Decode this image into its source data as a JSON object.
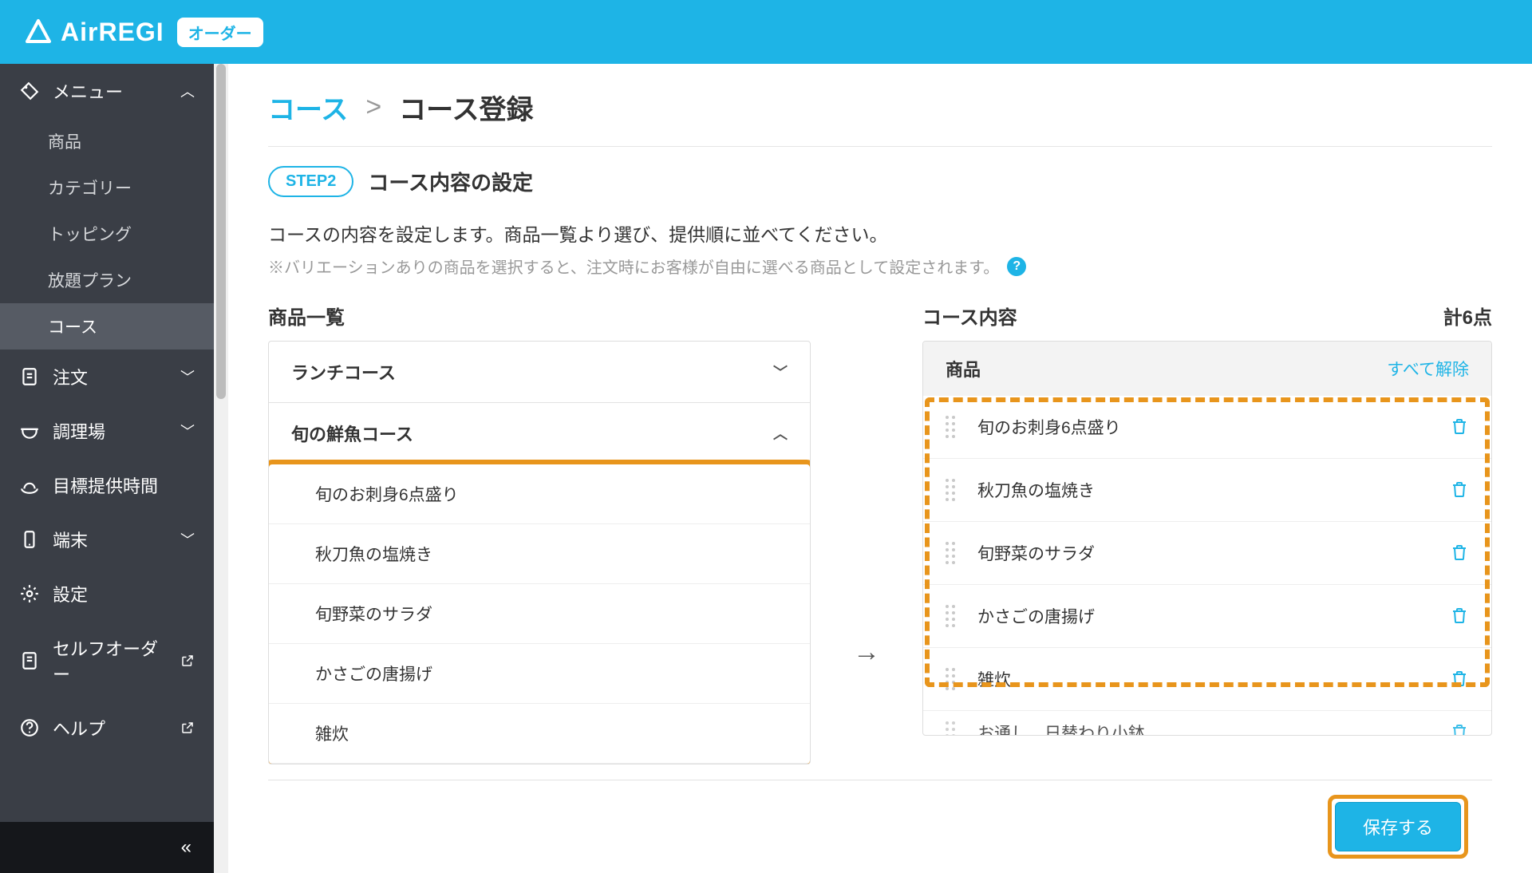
{
  "header": {
    "brand": "AirREGI",
    "badge": "オーダー"
  },
  "sidebar": {
    "menu_label": "メニュー",
    "menu_items": [
      "商品",
      "カテゴリー",
      "トッピング",
      "放題プラン",
      "コース"
    ],
    "active_sub_index": 4,
    "order_label": "注文",
    "kitchen_label": "調理場",
    "target_time_label": "目標提供時間",
    "device_label": "端末",
    "settings_label": "設定",
    "self_order_label": "セルフオーダー",
    "help_label": "ヘルプ"
  },
  "breadcrumb": {
    "link": "コース",
    "sep": ">",
    "current": "コース登録"
  },
  "step": {
    "pill": "STEP2",
    "title": "コース内容の設定"
  },
  "description": "コースの内容を設定します。商品一覧より選び、提供順に並べてください。",
  "subdescription": "※バリエーションありの商品を選択すると、注文時にお客様が自由に選べる商品として設定されます。",
  "left": {
    "title": "商品一覧",
    "groups": [
      {
        "name": "ランチコース",
        "expanded": false,
        "items": []
      },
      {
        "name": "旬の鮮魚コース",
        "expanded": true,
        "items": [
          "旬のお刺身6点盛り",
          "秋刀魚の塩焼き",
          "旬野菜のサラダ",
          "かさごの唐揚げ",
          "雑炊"
        ]
      }
    ]
  },
  "right": {
    "title": "コース内容",
    "count_label": "計6点",
    "header_label": "商品",
    "clear_label": "すべて解除",
    "items": [
      "旬のお刺身6点盛り",
      "秋刀魚の塩焼き",
      "旬野菜のサラダ",
      "かさごの唐揚げ",
      "雑炊"
    ],
    "partial_item": "お通し　日替わり小鉢"
  },
  "footer": {
    "save_label": "保存する"
  }
}
